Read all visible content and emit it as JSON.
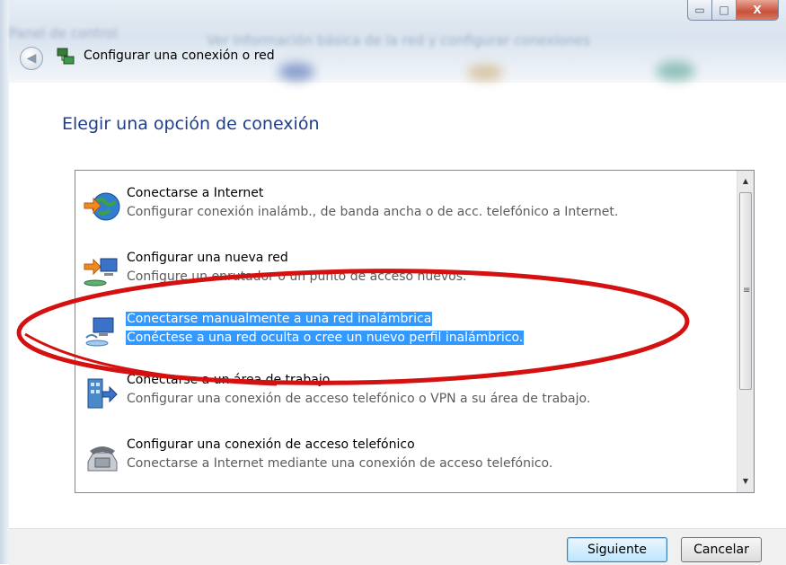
{
  "window": {
    "title": "Configurar una conexión o red",
    "background_blur_left": "Panel de control",
    "background_blur_right": "Ver información básica de la red y configurar conexiones",
    "caption_buttons": {
      "minimize": "▭",
      "maximize": "□",
      "close": "X"
    }
  },
  "nav": {
    "back_icon": "back-arrow-icon",
    "back_glyph": "◀"
  },
  "heading": "Elegir una opción de conexión",
  "options": [
    {
      "title": "Conectarse a Internet",
      "description": "Configurar conexión inalámb., de banda ancha o de acc. telefónico a Internet.",
      "icon": "globe-icon",
      "selected": false
    },
    {
      "title": "Configurar una nueva red",
      "description": "Configure un enrutador o un punto de acceso nuevos.",
      "icon": "new-network-icon",
      "selected": false
    },
    {
      "title": "Conectarse manualmente a una red inalámbrica",
      "description": "Conéctese a una red oculta o cree un nuevo perfil inalámbrico.",
      "icon": "wireless-network-icon",
      "selected": true
    },
    {
      "title": "Conectarse a un área de trabajo",
      "description": "Configurar una conexión de acceso telefónico o VPN a su área de trabajo.",
      "icon": "workplace-icon",
      "selected": false
    },
    {
      "title": "Configurar una conexión de acceso telefónico",
      "description": "Conectarse a Internet mediante una conexión de acceso telefónico.",
      "icon": "telephone-icon",
      "selected": false
    }
  ],
  "scrollbar": {
    "up": "▲",
    "down": "▼",
    "grip": "≡"
  },
  "buttons": {
    "next": "Siguiente",
    "cancel": "Cancelar"
  },
  "colors": {
    "accent_heading": "#1e3e8c",
    "selection": "#3399ff",
    "annotation_red": "#d41010"
  }
}
